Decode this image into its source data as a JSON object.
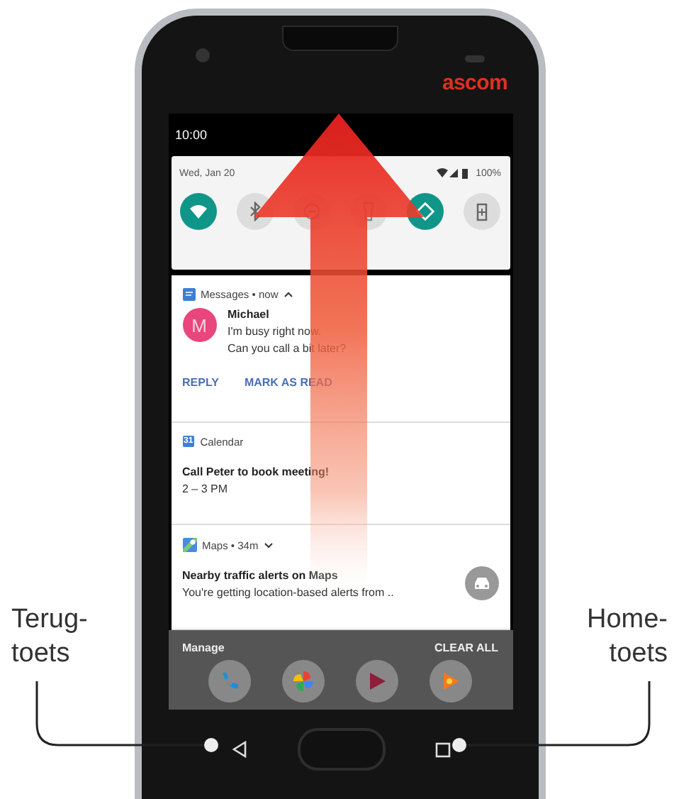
{
  "brand": "ascom",
  "status_bar": {
    "time": "10:00"
  },
  "quick_settings": {
    "date": "Wed, Jan 20",
    "battery": "100%",
    "tiles": [
      {
        "kind": "wifi",
        "on": true
      },
      {
        "kind": "bluetooth",
        "on": false
      },
      {
        "kind": "dnd",
        "on": false
      },
      {
        "kind": "flashlight",
        "on": false
      },
      {
        "kind": "rotate",
        "on": true
      },
      {
        "kind": "battery",
        "on": false
      }
    ]
  },
  "notifications": [
    {
      "kind": "message",
      "app": "Messages • now",
      "expanded": true,
      "sender": "Michael",
      "avatar": "M",
      "color": "#e8467c",
      "lines": [
        "I'm busy right now.",
        "Can you call a bit later?"
      ],
      "actions": [
        "REPLY",
        "MARK AS READ"
      ]
    },
    {
      "kind": "calendar",
      "app": "Calendar",
      "icon_text": "31",
      "title": "Call Peter to book meeting!",
      "subtitle": "2 – 3 PM"
    },
    {
      "kind": "maps",
      "app": "Maps • 34m",
      "expanded": false,
      "title": "Nearby traffic alerts on Maps",
      "subtitle": "You're getting location-based alerts from .."
    }
  ],
  "footer": {
    "manage": "Manage",
    "clear_all": "CLEAR ALL"
  },
  "dock": [
    {
      "kind": "phone"
    },
    {
      "kind": "photos"
    },
    {
      "kind": "movies"
    },
    {
      "kind": "music"
    }
  ],
  "callouts": {
    "left": "Terug-\ntoets",
    "right": "Home-\ntoets"
  }
}
